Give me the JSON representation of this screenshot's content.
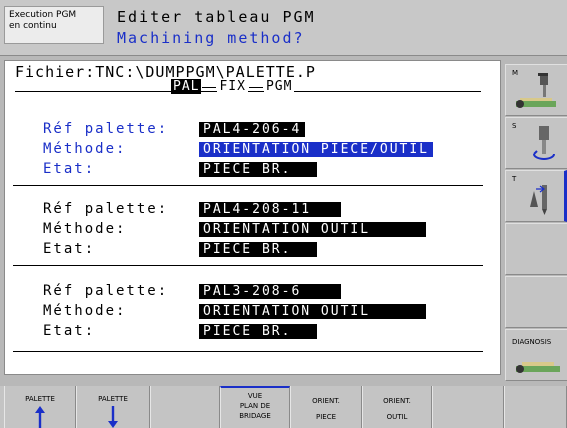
{
  "header": {
    "mode_line1": "Execution PGM",
    "mode_line2": "en continu",
    "title_line1": "Editer tableau PGM",
    "title_line2": "Machining method?"
  },
  "file": {
    "path": "Fichier:TNC:\\DUMPPGM\\PALETTE.P"
  },
  "tabs": [
    "PAL",
    "FIX",
    "PGM"
  ],
  "pallets": [
    {
      "ref_label": "Réf palette:",
      "ref_value": "PAL4-206-4",
      "method_label": "Méthode:",
      "method_value": "ORIENTATION PIECE/OUTIL",
      "state_label": "Etat:",
      "state_value": "PIECE BR."
    },
    {
      "ref_label": "Réf palette:",
      "ref_value": "PAL4-208-11",
      "method_label": "Méthode:",
      "method_value": "ORIENTATION OUTIL",
      "state_label": "Etat:",
      "state_value": "PIECE BR."
    },
    {
      "ref_label": "Réf palette:",
      "ref_value": "PAL3-208-6",
      "method_label": "Méthode:",
      "method_value": "ORIENTATION OUTIL",
      "state_label": "Etat:",
      "state_value": "PIECE BR."
    }
  ],
  "side_keys": {
    "m": "M",
    "s": "S",
    "t": "T",
    "diagnosis": "DIAGNOSIS"
  },
  "softkeys": {
    "palette_up": "PALETTE",
    "palette_down": "PALETTE",
    "vue_plan_l1": "VUE",
    "vue_plan_l2": "PLAN DE",
    "vue_plan_l3": "BRIDAGE",
    "orient_piece_l1": "ORIENT.",
    "orient_piece_l2": "PIECE",
    "orient_outil_l1": "ORIENT.",
    "orient_outil_l2": "OUTIL"
  },
  "colors": {
    "accent_blue": "#1a2fc8",
    "field_black": "#000000"
  }
}
